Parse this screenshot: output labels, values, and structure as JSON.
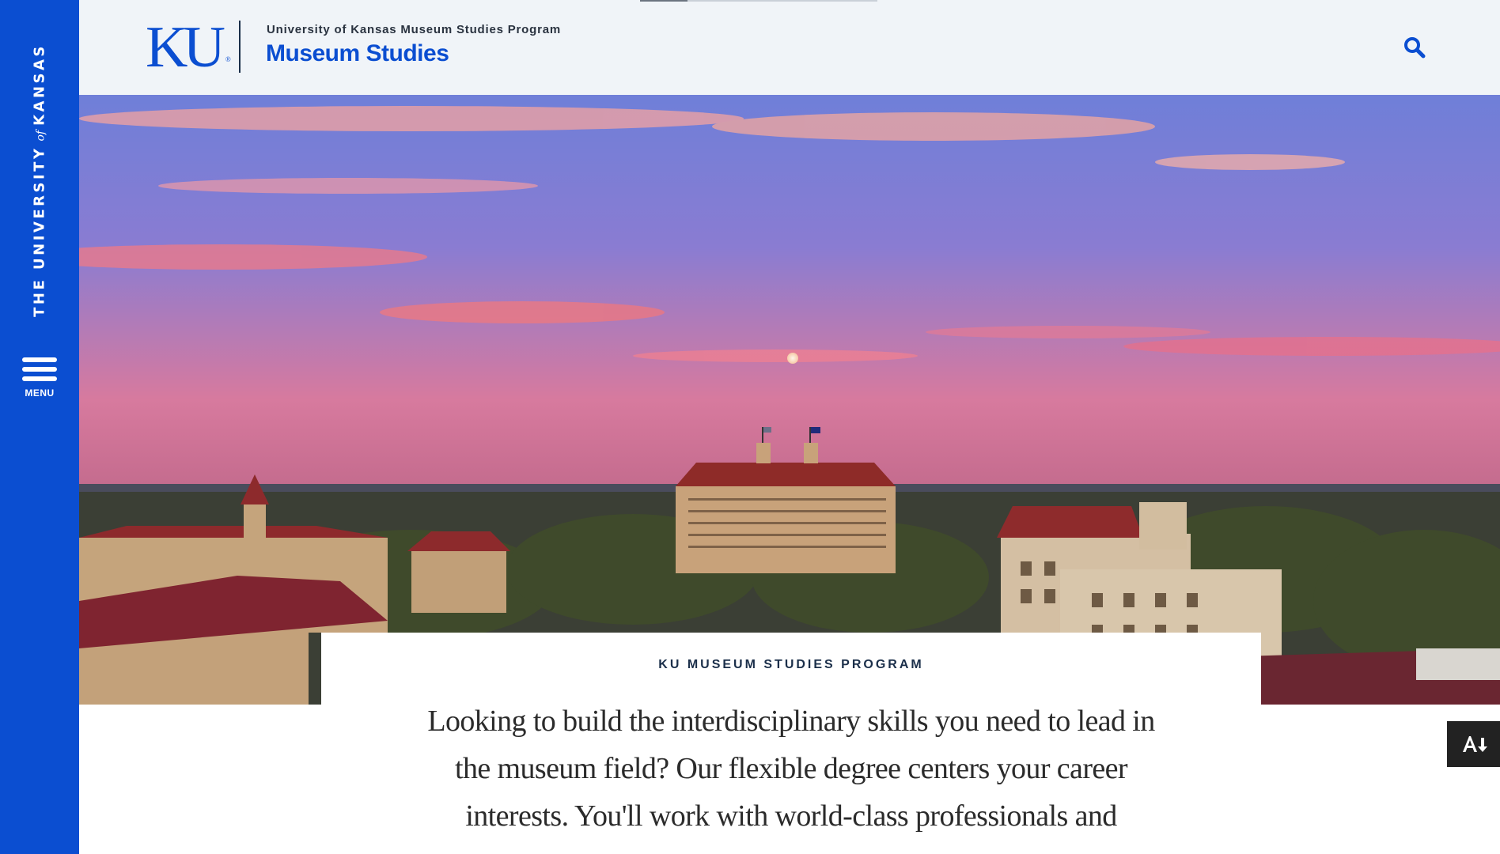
{
  "rail": {
    "wordmark_pre": "THE UNIVERSITY",
    "wordmark_of": "of",
    "wordmark_post": "KANSAS",
    "menu_label": "MENU",
    "menu_icon": "hamburger-icon"
  },
  "header": {
    "logo_text": "KU",
    "logo_mark": "®",
    "parent_site": "University of Kansas Museum Studies Program",
    "site_title": "Museum Studies",
    "search_icon": "search-icon"
  },
  "hero": {
    "image": "aerial-campus-sunset-photo"
  },
  "intro": {
    "eyebrow": "KU MUSEUM STUDIES PROGRAM",
    "lead": "Looking to build the interdisciplinary skills you need to lead in the museum field? Our flexible degree centers your career interests. You'll work with world-class professionals and"
  },
  "a11y_tool": {
    "icon": "text-resize-download-icon"
  },
  "colors": {
    "brand_blue": "#0b4ed1",
    "header_bg": "#f0f4f8",
    "navy_text": "#1b2f4a"
  }
}
